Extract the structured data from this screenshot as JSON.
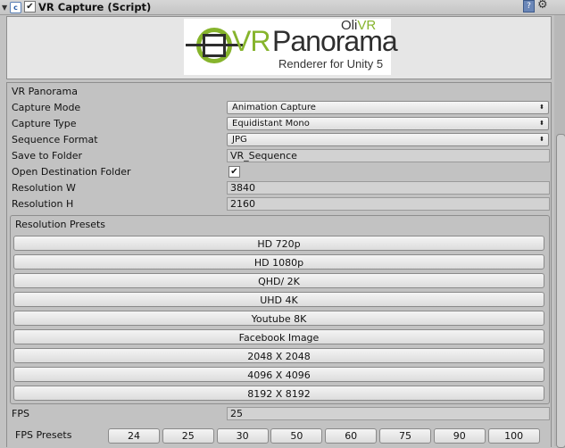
{
  "header": {
    "title": "VR Capture (Script)",
    "enabled": "✔",
    "icons": [
      "foldout-arrow-icon",
      "script-icon",
      "help-icon",
      "gear-icon"
    ]
  },
  "logo": {
    "vr": "VR",
    "panorama": "Panorama",
    "subtitle": "Renderer for Unity 5",
    "brand_a": "Oli",
    "brand_b": "VR",
    "colors": {
      "green": "#86b42c",
      "dark": "#2f2f2f"
    }
  },
  "section_title": "VR Panorama",
  "fields": {
    "capture_mode": {
      "label": "Capture Mode",
      "value": "Animation Capture"
    },
    "capture_type": {
      "label": "Capture Type",
      "value": "Equidistant Mono"
    },
    "sequence_format": {
      "label": "Sequence Format",
      "value": "JPG"
    },
    "save_to_folder": {
      "label": "Save to Folder",
      "value": "VR_Sequence"
    },
    "open_destination": {
      "label": "Open Destination Folder",
      "checked": "✔"
    },
    "resolution_w": {
      "label": "Resolution W",
      "value": "3840"
    },
    "resolution_h": {
      "label": "Resolution H",
      "value": "2160"
    },
    "fps": {
      "label": "FPS",
      "value": "25"
    }
  },
  "resolution_presets": {
    "title": "Resolution Presets",
    "buttons": [
      "HD 720p",
      "HD 1080p",
      "QHD/ 2K",
      "UHD 4K",
      "Youtube 8K",
      "Facebook Image",
      "2048 X 2048",
      "4096 X 4096",
      "8192 X 8192"
    ]
  },
  "fps_presets": {
    "label": "FPS Presets",
    "buttons": [
      "24",
      "25",
      "30",
      "50",
      "60",
      "75",
      "90",
      "100"
    ]
  }
}
